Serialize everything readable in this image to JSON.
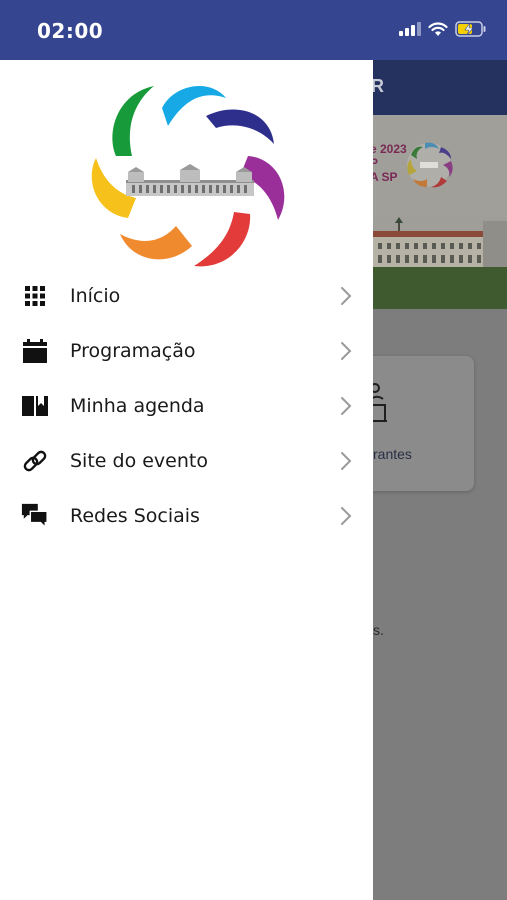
{
  "status_bar": {
    "time": "02:00",
    "icons": [
      "signal-icon",
      "wifi-icon",
      "battery-charging-icon"
    ]
  },
  "background_app": {
    "header_letter": "R",
    "banner_lines": [
      "e 2023",
      "P",
      "A SP"
    ],
    "card_label": "rantes",
    "misc_text": "s."
  },
  "drawer": {
    "menu_items": [
      {
        "label": "Início",
        "icon": "grid-icon"
      },
      {
        "label": "Programação",
        "icon": "calendar-icon"
      },
      {
        "label": "Minha agenda",
        "icon": "book-icon"
      },
      {
        "label": "Site do evento",
        "icon": "link-icon"
      },
      {
        "label": "Redes Sociais",
        "icon": "chat-bubbles-icon"
      }
    ]
  },
  "colors": {
    "status_bar": "#35458f",
    "app_header": "#25315e",
    "overlay": "#7d7d7d"
  }
}
